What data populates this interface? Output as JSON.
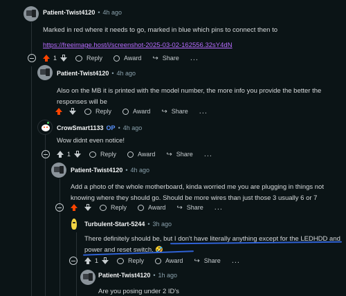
{
  "comments": [
    {
      "username": "Patient-Twist4120",
      "time": "4h ago",
      "body": "Marked in red where it needs to go, marked in blue which pins to connect then to",
      "link": "https://freeimage.host/i/screenshot-2025-03-02-162556.32sY4dN",
      "score": "1"
    },
    {
      "username": "Patient-Twist4120",
      "time": "4h ago",
      "body": "Also on the MB it is printed with the model number, the more info you provide the better the responses will be",
      "score": ""
    },
    {
      "username": "CrowSmart1133",
      "badge": "OP",
      "time": "4h ago",
      "body": "Wow didnt even notice!",
      "score": "1"
    },
    {
      "username": "Patient-Twist4120",
      "time": "4h ago",
      "body": "Add a photo of the whole motherboard, kinda worried me you are plugging in things not knowing where they should go. Should be more wires than just those 3 usually 6 or 7",
      "score": ""
    },
    {
      "username": "Turbulent-Start-5244",
      "time": "3h ago",
      "body": "There definitely should be, but I don't have literally anything except for the LEDHDD and power and reset switch. 🤣",
      "score": "1"
    },
    {
      "username": "Patient-Twist4120",
      "time": "1h ago",
      "body": "Are you posing under 2 ID's",
      "score": ""
    }
  ],
  "actions": {
    "reply": "Reply",
    "award": "Award",
    "share": "Share",
    "more": "..."
  },
  "separator": "•",
  "colors": {
    "background": "#0b1416",
    "upvote_active": "#ff4500",
    "link": "#b76cff",
    "op_badge": "#5a93ff",
    "annotation": "#2f62d6"
  }
}
